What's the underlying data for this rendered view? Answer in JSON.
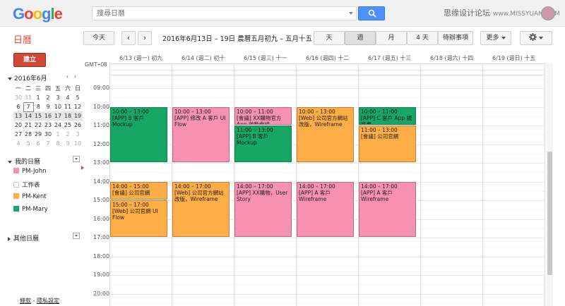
{
  "app": {
    "logo_letters": [
      {
        "ch": "G",
        "color": "#4285f4"
      },
      {
        "ch": "o",
        "color": "#ea4335"
      },
      {
        "ch": "o",
        "color": "#fbbc05"
      },
      {
        "ch": "g",
        "color": "#4285f4"
      },
      {
        "ch": "l",
        "color": "#34a853"
      },
      {
        "ch": "e",
        "color": "#ea4335"
      }
    ],
    "search_placeholder": "搜尋日曆",
    "watermark": "思缘设计论坛",
    "watermark_url": "www.MISSYUAN.COM"
  },
  "toolbar": {
    "title": "日曆",
    "today": "今天",
    "prev": "‹",
    "next": "›",
    "date_range": "2016年6月13日 – 19日 農曆五月初九 – 五月十五",
    "views": [
      "天",
      "週",
      "月",
      "4 天",
      "待辦事項"
    ],
    "active_view": "週",
    "more": "更多",
    "settings_icon": "gear-icon"
  },
  "sidebar": {
    "create": "建立",
    "month_label": "2016年6月",
    "weekday_headers": [
      "一",
      "二",
      "三",
      "四",
      "五",
      "六",
      "日"
    ],
    "weeks": [
      [
        "30",
        "31",
        "1",
        "2",
        "3",
        "4",
        "5"
      ],
      [
        "6",
        "7",
        "8",
        "9",
        "10",
        "11",
        "12"
      ],
      [
        "13",
        "14",
        "15",
        "16",
        "17",
        "18",
        "19"
      ],
      [
        "20",
        "21",
        "22",
        "23",
        "24",
        "25",
        "26"
      ],
      [
        "27",
        "28",
        "29",
        "30",
        "1",
        "2",
        "3"
      ],
      [
        "4",
        "5",
        "6",
        "7",
        "8",
        "9",
        "10"
      ]
    ],
    "my_calendars_label": "我的日曆",
    "calendars": [
      {
        "name": "PM-John",
        "color": "#f691b2"
      },
      {
        "name": "工作表",
        "color": "#ffffff"
      },
      {
        "name": "PM-Kent",
        "color": "#ffad46"
      },
      {
        "name": "PM-Mary",
        "color": "#16a765"
      }
    ],
    "other_calendars_label": "其他日曆",
    "footer_terms": "條款",
    "footer_sep": " - ",
    "footer_privacy": "隱私設定"
  },
  "grid": {
    "timezone": "GMT+08",
    "days": [
      "6/13 (週一) 初九",
      "6/14 (週二) 初十",
      "6/15 (週三) 十一",
      "6/16 (週四) 十二",
      "6/17 (週五) 十三",
      "6/18 (週六) 十四",
      "6/19 (週日) 十五"
    ],
    "hours": [
      "09:00",
      "10:00",
      "11:00",
      "12:00",
      "13:00",
      "14:00",
      "15:00",
      "16:00",
      "17:00",
      "18:00",
      "19:00",
      "20:00"
    ]
  },
  "events": [
    {
      "day": 0,
      "start": 10,
      "end": 13,
      "time": "10:00 – 13:00",
      "title": "[APP] B 客戶 Mockup",
      "color": "green"
    },
    {
      "day": 1,
      "start": 10,
      "end": 13,
      "time": "10:00 – 13:00",
      "title": "[APP] 修改 A 客戶 UI Flow",
      "color": "pink"
    },
    {
      "day": 2,
      "start": 10,
      "end": 11,
      "time": "10:00 – 11:00",
      "title": "[會議] XX購物官方 App 啟動會議",
      "color": "pink"
    },
    {
      "day": 2,
      "start": 11,
      "end": 13,
      "time": "11:00 – 13:00",
      "title": "[APP] B 客戶 Mockup",
      "color": "green"
    },
    {
      "day": 3,
      "start": 10,
      "end": 13,
      "time": "10:00 – 13:00",
      "title": "[Web] 公司官方網站改版，Wireframe",
      "color": "orange"
    },
    {
      "day": 4,
      "start": 10,
      "end": 11,
      "time": "10:00 – 11:00",
      "title": "[APP] C 客戶 App 規格書",
      "color": "green"
    },
    {
      "day": 4,
      "start": 11,
      "end": 13,
      "time": "11:00 – 13:00",
      "title": "[會議] 公司官網",
      "color": "orange"
    },
    {
      "day": 0,
      "start": 14,
      "end": 15,
      "time": "14:00 – 15:00",
      "title": "[會議] 公司官網",
      "color": "orange"
    },
    {
      "day": 0,
      "start": 15,
      "end": 17,
      "time": "15:00 – 17:00",
      "title": "[Web] 公司官網 UI Flow",
      "color": "orange"
    },
    {
      "day": 1,
      "start": 14,
      "end": 17,
      "time": "14:00 – 17:00",
      "title": "[Web] 公司官方網站改版，Wireframe",
      "color": "orange"
    },
    {
      "day": 2,
      "start": 14,
      "end": 17,
      "time": "14:00 – 17:00",
      "title": "[APP] XX購物，User Story",
      "color": "pink"
    },
    {
      "day": 3,
      "start": 14,
      "end": 17,
      "time": "14:00 – 17:00",
      "title": "[APP] A 客戶 Wireframe",
      "color": "pink"
    },
    {
      "day": 4,
      "start": 14,
      "end": 17,
      "time": "14:00 – 17:00",
      "title": "[APP] A 客戶 Wireframe",
      "color": "pink"
    }
  ]
}
